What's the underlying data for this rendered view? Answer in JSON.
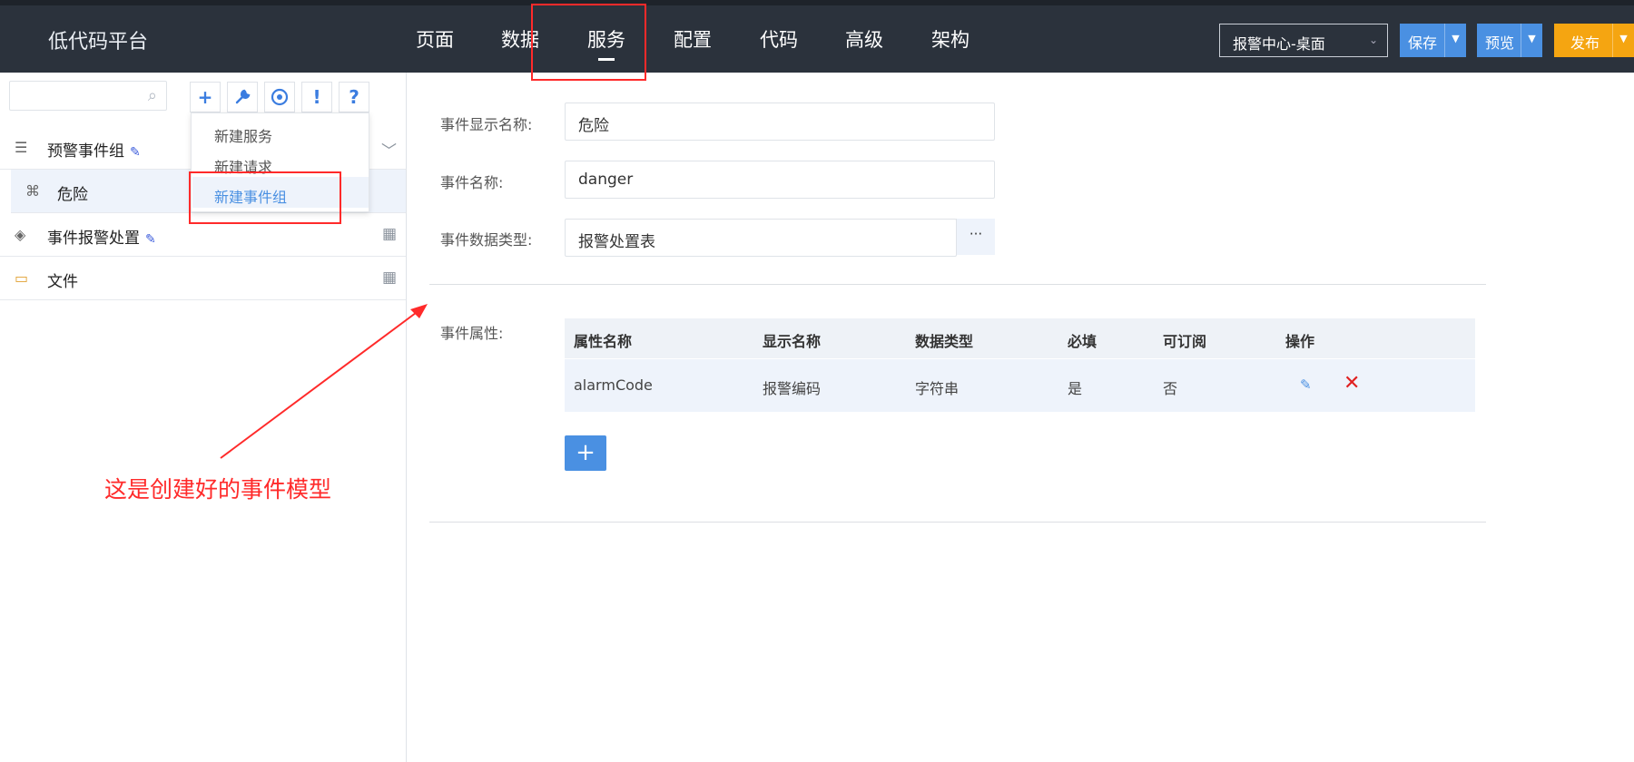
{
  "header": {
    "logo": "低代码平台",
    "nav": [
      "页面",
      "数据",
      "服务",
      "配置",
      "代码",
      "高级",
      "架构"
    ],
    "workspace": "报警中心-桌面",
    "buttons": {
      "save": "保存",
      "preview": "预览",
      "publish": "发布"
    }
  },
  "toolbar": {
    "search_placeholder": "",
    "tools": [
      "+",
      "wrench",
      "target",
      "!",
      "?"
    ]
  },
  "tree": {
    "group": "预警事件组",
    "group_child": "危险",
    "item2": "事件报警处置",
    "item3": "文件"
  },
  "menu": {
    "items": [
      "新建服务",
      "新建请求",
      "新建事件组"
    ]
  },
  "form": {
    "display_name_label": "事件显示名称:",
    "display_name_value": "危险",
    "name_label": "事件名称:",
    "name_value": "danger",
    "data_type_label": "事件数据类型:",
    "data_type_value": "报警处置表",
    "picker": "···",
    "attr_label": "事件属性:"
  },
  "table": {
    "headers": [
      "属性名称",
      "显示名称",
      "数据类型",
      "必填",
      "可订阅",
      "操作"
    ],
    "rows": [
      {
        "name": "alarmCode",
        "display": "报警编码",
        "type": "字符串",
        "required": "是",
        "subscribable": "否"
      }
    ]
  },
  "add_label": "+",
  "annotation": "这是创建好的事件模型",
  "colors": {
    "accent": "#4a90e2",
    "publish": "#f5a511",
    "annotation": "#ff2a2a",
    "topbar": "#2b323c"
  }
}
